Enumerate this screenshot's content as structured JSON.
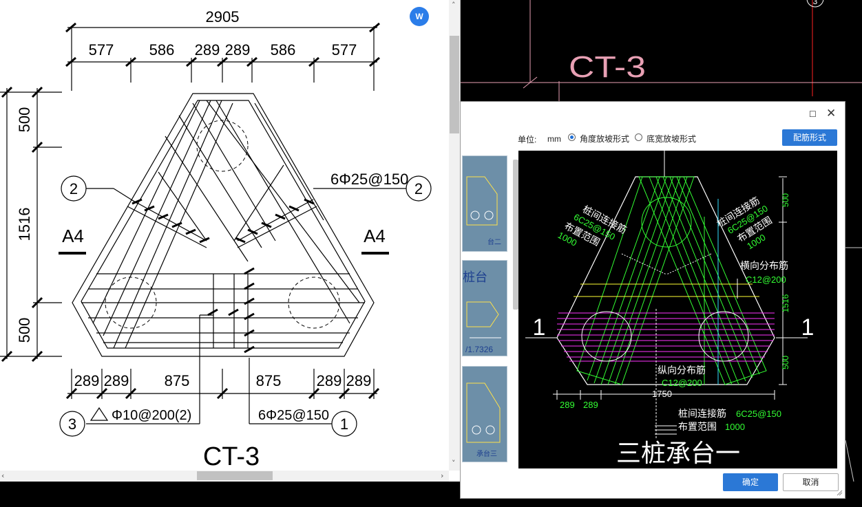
{
  "background_cad": {
    "title": "CT-3",
    "corner_marker": "3"
  },
  "preview": {
    "word_icon_text": "W",
    "title": "CT-3",
    "top_total": "2905",
    "top_dims": [
      "577",
      "586",
      "289",
      "289",
      "586",
      "577"
    ],
    "left_dims": [
      "500",
      "1516",
      "500"
    ],
    "bottom_dims": [
      "289",
      "289",
      "875",
      "875",
      "289",
      "289"
    ],
    "section_left": "A4",
    "section_right": "A4",
    "callout_left_num": "2",
    "callout_right_num": "2",
    "callout_right_text": "6Φ25@150",
    "callout_3_num": "3",
    "callout_3_text": "Φ10@200(2)",
    "callout_1_num": "1",
    "callout_1_text": "6Φ25@150"
  },
  "dialog": {
    "unit_label": "单位:",
    "unit_value": "mm",
    "option_angle": "角度放坡形式",
    "option_width": "底宽放坡形式",
    "selected_option": "角度放坡形式",
    "rebar_style_button": "配筋形式",
    "ok_button": "确定",
    "cancel_button": "取消",
    "thumbnails": [
      {
        "caption": "台二"
      },
      {
        "caption": "桩台",
        "value": "/1.7326"
      },
      {
        "caption": "承台三"
      }
    ],
    "canvas": {
      "title": "三桩承台一",
      "section_left": "1",
      "section_right": "1",
      "left_rebar_label": "桩间连接筋",
      "left_rebar_value": "6C25@150",
      "left_range_label": "布置范围",
      "left_range_value": "1000",
      "right_rebar_label": "桩间连接筋",
      "right_rebar_value": "6C25@150",
      "right_range_label": "布置范围",
      "right_range_value": "1000",
      "transverse_label": "横向分布筋",
      "transverse_value": "C12@200",
      "longitudinal_label": "纵向分布筋",
      "longitudinal_value": "C12@200",
      "bottom_rebar_label": "桩间连接筋",
      "bottom_rebar_value": "6C25@150",
      "bottom_range_label": "布置范围",
      "bottom_range_value": "1000",
      "dim_right": [
        "500",
        "1516",
        "500"
      ],
      "dim_bottom_small": [
        "289",
        "289"
      ],
      "dim_bottom_total": "1750"
    }
  },
  "colors": {
    "dialog_button": "#2b78d6",
    "cad_green": "#33ff33",
    "cad_magenta": "#ff33ff",
    "cad_yellow": "#ffff33",
    "cad_cyan": "#33e0ff"
  }
}
